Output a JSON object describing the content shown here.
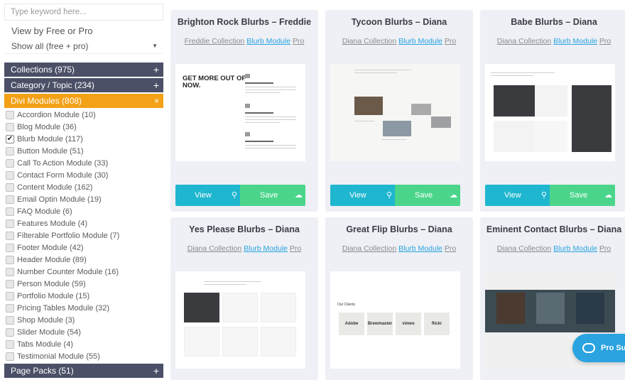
{
  "sidebar": {
    "search_placeholder": "Type keyword here...",
    "view_by_label": "View by Free or Pro",
    "filter_selected": "Show all (free + pro)",
    "sections": [
      {
        "label": "Collections (975)",
        "sign": "+"
      },
      {
        "label": "Category / Topic (234)",
        "sign": "+"
      },
      {
        "label": "Divi Modules (808)",
        "sign": "×"
      },
      {
        "label": "Page Packs (51)",
        "sign": "+"
      }
    ],
    "modules": [
      {
        "label": "Accordion Module (10)",
        "checked": false
      },
      {
        "label": "Blog Module (36)",
        "checked": false
      },
      {
        "label": "Blurb Module (117)",
        "checked": true
      },
      {
        "label": "Button Module (51)",
        "checked": false
      },
      {
        "label": "Call To Action Module (33)",
        "checked": false
      },
      {
        "label": "Contact Form Module (30)",
        "checked": false
      },
      {
        "label": "Content Module (162)",
        "checked": false
      },
      {
        "label": "Email Optin Module (19)",
        "checked": false
      },
      {
        "label": "FAQ Module (6)",
        "checked": false
      },
      {
        "label": "Features Module (4)",
        "checked": false
      },
      {
        "label": "Filterable Portfolio Module (7)",
        "checked": false
      },
      {
        "label": "Footer Module (42)",
        "checked": false
      },
      {
        "label": "Header Module (89)",
        "checked": false
      },
      {
        "label": "Number Counter Module (16)",
        "checked": false
      },
      {
        "label": "Person Module (59)",
        "checked": false
      },
      {
        "label": "Portfolio Module (15)",
        "checked": false
      },
      {
        "label": "Pricing Tables Module (32)",
        "checked": false
      },
      {
        "label": "Shop Module (3)",
        "checked": false
      },
      {
        "label": "Slider Module (54)",
        "checked": false
      },
      {
        "label": "Tabs Module (4)",
        "checked": false
      },
      {
        "label": "Testimonial Module (55)",
        "checked": false
      }
    ]
  },
  "cards": [
    {
      "title": "Brighton Rock Blurbs – Freddie",
      "collection": "Freddie Collection",
      "module": "Blurb Module",
      "tier": "Pro",
      "preview_headline": "GET MORE OUT OF NOW."
    },
    {
      "title": "Tycoon Blurbs – Diana",
      "collection": "Diana Collection",
      "module": "Blurb Module",
      "tier": "Pro"
    },
    {
      "title": "Babe Blurbs – Diana",
      "collection": "Diana Collection",
      "module": "Blurb Module",
      "tier": "Pro"
    },
    {
      "title": "Yes Please Blurbs – Diana",
      "collection": "Diana Collection",
      "module": "Blurb Module",
      "tier": "Pro"
    },
    {
      "title": "Great Flip Blurbs – Diana",
      "collection": "Diana Collection",
      "module": "Blurb Module",
      "tier": "Pro",
      "preview_heading": "Our Clients",
      "preview_logos": [
        "Adobe",
        "Brewmaster",
        "vimeo",
        "flickr"
      ]
    },
    {
      "title": "Eminent Contact Blurbs – Diana",
      "collection": "Diana Collection",
      "module": "Blurb Module",
      "tier": "Pro"
    }
  ],
  "buttons": {
    "view_label": "View",
    "save_label": "Save"
  },
  "support": {
    "label": "Pro Su"
  },
  "colors": {
    "accent_blue": "#2aa3e0",
    "view_button": "#1fb6cf",
    "save_button": "#4bd58b",
    "section_header": "#4b5067",
    "active_section": "#f3a117"
  }
}
